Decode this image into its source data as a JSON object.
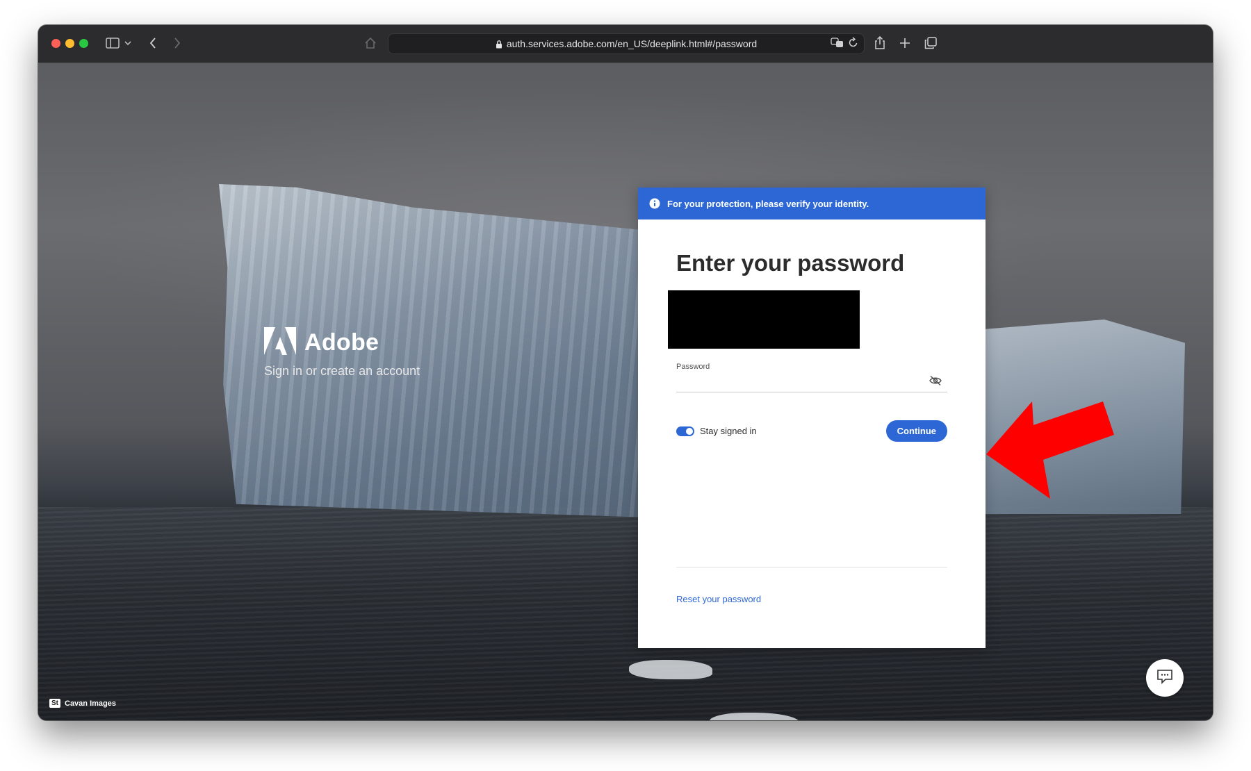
{
  "browser": {
    "url": "auth.services.adobe.com/en_US/deeplink.html#/password",
    "icons": [
      "sidebar-icon",
      "chevron-down-icon",
      "back-icon",
      "forward-icon",
      "home-icon",
      "lock-icon",
      "translate-icon",
      "reload-icon",
      "share-icon",
      "new-tab-icon",
      "tabs-overview-icon"
    ]
  },
  "brand": {
    "name": "Adobe",
    "tagline": "Sign in or create an account"
  },
  "card": {
    "banner": "For your protection, please verify your identity.",
    "title": "Enter your password",
    "password_label": "Password",
    "password_value": "",
    "stay_signed_in_label": "Stay signed in",
    "stay_signed_in": true,
    "continue_label": "Continue",
    "reset_link": "Reset your password"
  },
  "credit": {
    "badge": "St",
    "text": "Cavan Images"
  },
  "colors": {
    "accent": "#2d67d6",
    "annotation_arrow": "#ff0000"
  }
}
